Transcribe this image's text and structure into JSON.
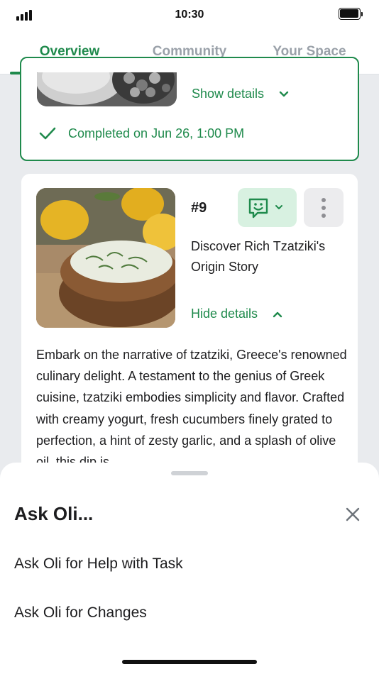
{
  "status_bar": {
    "time": "10:30",
    "signal_icon": "cellular-signal-icon",
    "battery_icon": "battery-icon"
  },
  "tabs": [
    {
      "label": "Overview",
      "active": true
    },
    {
      "label": "Community",
      "active": false
    },
    {
      "label": "Your Space",
      "active": false
    }
  ],
  "card1": {
    "show_details_label": "Show details",
    "completed_text": "Completed on Jun 26, 1:00 PM"
  },
  "card2": {
    "number": "#9",
    "title": "Discover Rich Tzatziki's Origin Story",
    "hide_details_label": "Hide details",
    "description": "Embark on the narrative of tzatziki, Greece's renowned culinary delight. A testament to the genius of Greek cuisine, tzatziki embodies simplicity and flavor. Crafted with creamy yogurt, fresh cucumbers finely grated to perfection, a hint of zesty garlic, and a splash of olive oil, this dip is",
    "feedback_icon": "chat-smile-icon",
    "more_icon": "more-vertical-icon"
  },
  "sheet": {
    "title": "Ask Oli...",
    "items": [
      "Ask Oli for Help with Task",
      "Ask Oli for Changes"
    ],
    "close_icon": "close-icon"
  },
  "colors": {
    "accent": "#1f8a4c",
    "accent_light": "#d8f1e1",
    "background": "#e9ebee",
    "inactive_tab": "#9aa1a9"
  }
}
